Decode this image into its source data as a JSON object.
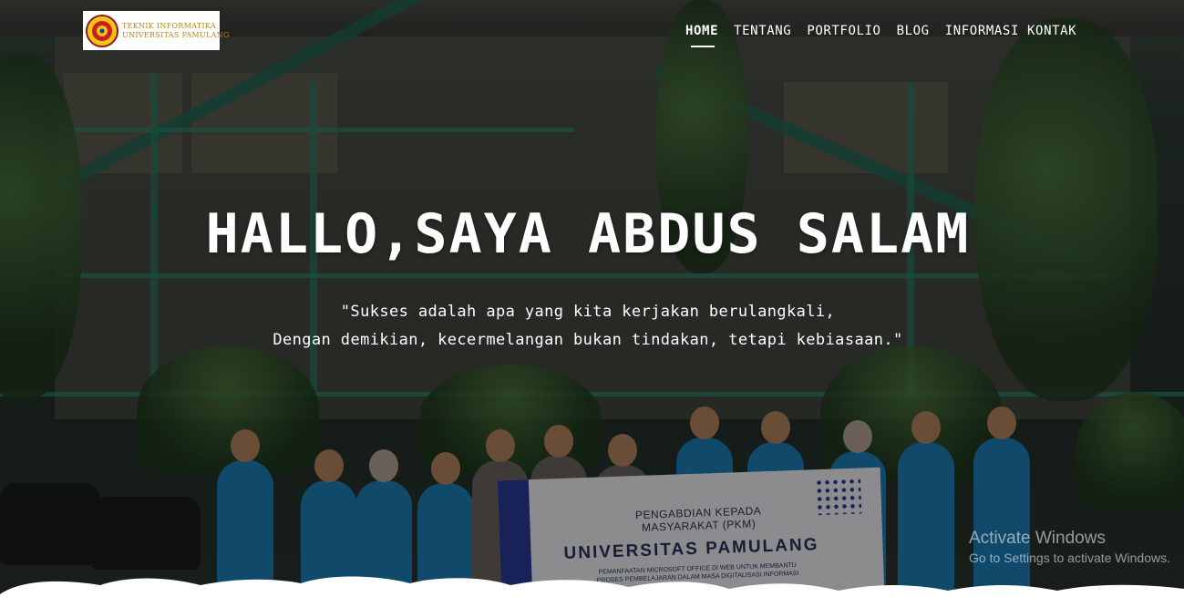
{
  "logo": {
    "line1": "TEKNIK INFORMATIKA",
    "line2": "UNIVERSITAS PAMULANG"
  },
  "nav": {
    "items": [
      "HOME",
      "TENTANG",
      "PORTFOLIO",
      "BLOG",
      "INFORMASI KONTAK"
    ],
    "active": "HOME"
  },
  "hero": {
    "title": "HALLO,SAYA ABDUS SALAM",
    "quote_line1": "\"Sukses adalah apa yang kita kerjakan berulangkali,",
    "quote_line2": "Dengan demikian, kecermelangan bukan tindakan, tetapi kebiasaan.\""
  },
  "banner": {
    "line1": "PENGABDIAN KEPADA",
    "line2": "MASYARAKAT (PKM)",
    "line3": "UNIVERSITAS PAMULANG",
    "line4": "PEMANFAATAN MICROSOFT OFFICE DI WEB UNTUK MEMBANTU",
    "line5": "PROSES PEMBELAJARAN DALAM MASA DIGITALISASI INFORMASI"
  },
  "watermark": {
    "title": "Activate Windows",
    "subtitle": "Go to Settings to activate Windows."
  },
  "colors": {
    "overlay": "rgba(0,0,0,0.42)",
    "nav_text": "#ffffff",
    "logo_text": "#b8860b",
    "jacket": "#1c7fb6"
  }
}
